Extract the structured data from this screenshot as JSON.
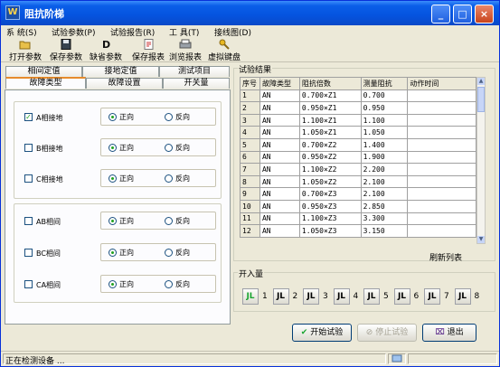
{
  "window": {
    "title": "阻抗阶梯",
    "app_icon": "app-icon"
  },
  "title_buttons": {
    "minimize": "_",
    "maximize": "□",
    "close": "×"
  },
  "menu": [
    "系 统(S)",
    "试验参数(P)",
    "试验报告(R)",
    "工 具(T)",
    "接线图(D)"
  ],
  "toolbar": [
    {
      "label": "打开参数",
      "icon": "open-folder-icon"
    },
    {
      "label": "保存参数",
      "icon": "save-disk-icon"
    },
    {
      "label": "缺省参数",
      "icon": "default-params-icon"
    },
    {
      "label": "保存报表",
      "icon": "save-report-icon"
    },
    {
      "label": "浏览报表",
      "icon": "print-preview-icon"
    },
    {
      "label": "虚拟键盘",
      "icon": "keyboard-key-icon"
    }
  ],
  "tabs_row1": [
    "相间定值",
    "接地定值",
    "测试项目"
  ],
  "tabs_row2": [
    "故障类型",
    "故障设置",
    "开关量"
  ],
  "fault_groups": [
    [
      {
        "label": "A相接地",
        "checked": true,
        "forward": "正向",
        "reverse": "反向"
      },
      {
        "label": "B相接地",
        "checked": false,
        "forward": "正向",
        "reverse": "反向"
      },
      {
        "label": "C相接地",
        "checked": false,
        "forward": "正向",
        "reverse": "反向"
      }
    ],
    [
      {
        "label": "AB相间",
        "checked": false,
        "forward": "正向",
        "reverse": "反向"
      },
      {
        "label": "BC相间",
        "checked": false,
        "forward": "正向",
        "reverse": "反向"
      },
      {
        "label": "CA相间",
        "checked": false,
        "forward": "正向",
        "reverse": "反向"
      }
    ]
  ],
  "results": {
    "title": "试验结果",
    "columns": [
      "序号",
      "故障类型",
      "阻抗倍数",
      "测量阻抗",
      "动作时间"
    ],
    "rows": [
      [
        "1",
        "AN",
        "0.700×Z1",
        "0.700",
        ""
      ],
      [
        "2",
        "AN",
        "0.950×Z1",
        "0.950",
        ""
      ],
      [
        "3",
        "AN",
        "1.100×Z1",
        "1.100",
        ""
      ],
      [
        "4",
        "AN",
        "1.050×Z1",
        "1.050",
        ""
      ],
      [
        "5",
        "AN",
        "0.700×Z2",
        "1.400",
        ""
      ],
      [
        "6",
        "AN",
        "0.950×Z2",
        "1.900",
        ""
      ],
      [
        "7",
        "AN",
        "1.100×Z2",
        "2.200",
        ""
      ],
      [
        "8",
        "AN",
        "1.050×Z2",
        "2.100",
        ""
      ],
      [
        "9",
        "AN",
        "0.700×Z3",
        "2.100",
        ""
      ],
      [
        "10",
        "AN",
        "0.950×Z3",
        "2.850",
        ""
      ],
      [
        "11",
        "AN",
        "1.100×Z3",
        "3.300",
        ""
      ],
      [
        "12",
        "AN",
        "1.050×Z3",
        "3.150",
        ""
      ]
    ],
    "refresh_label": "刷新列表"
  },
  "switch_inputs": {
    "title": "开入量",
    "items": [
      {
        "num": "1",
        "active": true
      },
      {
        "num": "2",
        "active": false
      },
      {
        "num": "3",
        "active": false
      },
      {
        "num": "4",
        "active": false
      },
      {
        "num": "5",
        "active": false
      },
      {
        "num": "6",
        "active": false
      },
      {
        "num": "7",
        "active": false
      },
      {
        "num": "8",
        "active": false
      }
    ]
  },
  "actions": {
    "start": "开始试验",
    "stop": "停止试验",
    "exit": "退出"
  },
  "status": {
    "text": "正在检测设备 ..."
  },
  "colors": {
    "title_bar": "#0553df",
    "active_green": "#1aa531",
    "tab_highlight": "#e68b2c"
  }
}
